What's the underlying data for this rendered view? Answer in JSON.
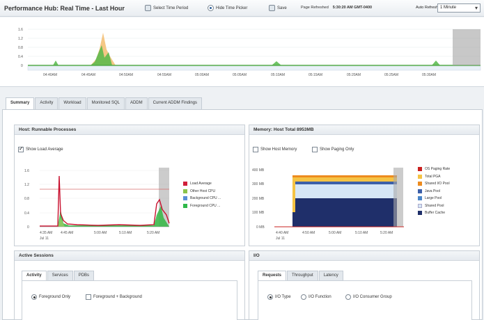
{
  "header": {
    "title": "Performance Hub: Real Time - Last Hour",
    "select_time_period": "Select Time Period",
    "hide_time_picker": "Hide Time Picker",
    "save": "Save",
    "page_refreshed_label": "Page Refreshed",
    "page_refreshed_value": "5:30:20 AM GMT-0400",
    "auto_refresh_label": "Auto Refresh",
    "auto_refresh_value": "1 Minute"
  },
  "timeline": {
    "y_ticks": [
      "1.6",
      "1.2",
      "0.8",
      "0.4",
      "0"
    ],
    "x_ticks": [
      "04:40AM",
      "04:45AM",
      "04:50AM",
      "04:55AM",
      "05:00AM",
      "05:05AM",
      "05:10AM",
      "05:15AM",
      "05:20AM",
      "05:25AM",
      "05:30AM"
    ]
  },
  "tabs": [
    "Summary",
    "Activity",
    "Workload",
    "Monitored SQL",
    "ADDM",
    "Current ADDM Findings"
  ],
  "host_panel": {
    "title": "Host: Runnable Processes",
    "show_load_average": "Show Load Average",
    "y_ticks": [
      "1.6",
      "1.2",
      "0.8",
      "0.4",
      "0"
    ],
    "x_ticks": [
      "4:35 AM",
      "4:45 AM",
      "5:00 AM",
      "5:10 AM",
      "5:20 AM"
    ],
    "x_sub": "Jul 11",
    "legend": [
      {
        "label": "Load Average",
        "color": "#d11f3a"
      },
      {
        "label": "Other Host CPU",
        "color": "#8bc34a"
      },
      {
        "label": "Background CPU ...",
        "color": "#5b8fd6"
      },
      {
        "label": "Foreground CPU ...",
        "color": "#2fb84a"
      }
    ]
  },
  "memory_panel": {
    "title": "Memory: Host Total 8953MB",
    "show_host_memory": "Show Host Memory",
    "show_paging_only": "Show Paging Only",
    "y_ticks": [
      "400 MB",
      "300 MB",
      "200 MB",
      "100 MB",
      "0 MB"
    ],
    "x_ticks": [
      "4:40 AM",
      "4:50 AM",
      "5:00 AM",
      "5:10 AM",
      "5:20 AM"
    ],
    "x_sub": "Jul 11",
    "legend": [
      {
        "label": "OS Paging Rate",
        "color": "#c9201f"
      },
      {
        "label": "Total PGA",
        "color": "#f5c344"
      },
      {
        "label": "Shared I/O Pool",
        "color": "#ed8b1f"
      },
      {
        "label": "Java Pool",
        "color": "#3c5fa8"
      },
      {
        "label": "Large Pool",
        "color": "#4a86c8"
      },
      {
        "label": "Shared Pool",
        "color": "#d6e6f5"
      },
      {
        "label": "Buffer Cache",
        "color": "#1f2f6a"
      }
    ]
  },
  "sessions_panel": {
    "title": "Active Sessions",
    "tabs": [
      "Activity",
      "Services",
      "PDBs"
    ],
    "foreground_only": "Foreground Only",
    "foreground_background": "Foreground + Background"
  },
  "io_panel": {
    "title": "I/O",
    "tabs": [
      "Requests",
      "Throughput",
      "Latency"
    ],
    "io_type": "I/O Type",
    "io_function": "I/O Function",
    "io_consumer_group": "I/O Consumer Group"
  }
}
